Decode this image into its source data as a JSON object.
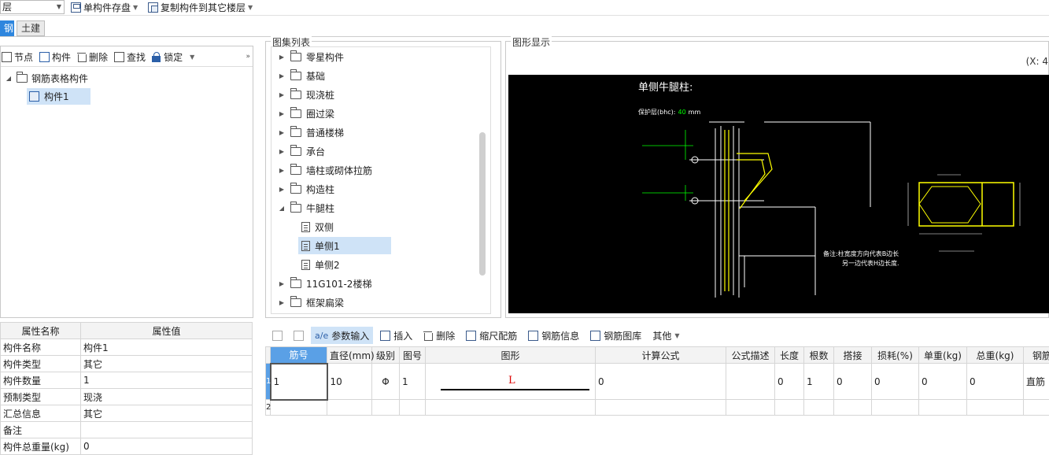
{
  "toolbar": {
    "floor_combo": "层",
    "save_label": "单构件存盘",
    "copy_label": "复制构件到其它楼层"
  },
  "module_tabs": [
    {
      "label": "钢筋",
      "active": true
    },
    {
      "label": "土建",
      "active": false
    }
  ],
  "left_tools": {
    "node": "节点",
    "component": "构件",
    "delete": "删除",
    "find": "查找",
    "lock": "锁定"
  },
  "tree": {
    "root": "钢筋表格构件",
    "child": "构件1"
  },
  "props": {
    "header_name": "属性名称",
    "header_value": "属性值",
    "rows": [
      {
        "name": "构件名称",
        "value": "构件1"
      },
      {
        "name": "构件类型",
        "value": "其它"
      },
      {
        "name": "构件数量",
        "value": "1"
      },
      {
        "name": "预制类型",
        "value": "现浇"
      },
      {
        "name": "汇总信息",
        "value": "其它"
      },
      {
        "name": "备注",
        "value": ""
      },
      {
        "name": "构件总重量(kg)",
        "value": "0"
      }
    ]
  },
  "atlas": {
    "title": "图集列表",
    "items": [
      {
        "label": "零星构件",
        "expanded": false
      },
      {
        "label": "基础",
        "expanded": false
      },
      {
        "label": "现浇桩",
        "expanded": false
      },
      {
        "label": "圈过梁",
        "expanded": false
      },
      {
        "label": "普通楼梯",
        "expanded": false
      },
      {
        "label": "承台",
        "expanded": false
      },
      {
        "label": "墙柱或砌体拉筋",
        "expanded": false
      },
      {
        "label": "构造柱",
        "expanded": false
      },
      {
        "label": "牛腿柱",
        "expanded": true
      },
      {
        "label": "11G101-2楼梯",
        "expanded": false
      },
      {
        "label": "框架扁梁",
        "expanded": false
      }
    ],
    "children": [
      {
        "label": "双侧"
      },
      {
        "label": "单侧1"
      },
      {
        "label": "单侧2"
      }
    ]
  },
  "graphic": {
    "title": "图形显示",
    "coord": "(X: 4",
    "drawing_title": "单侧牛腿柱:",
    "cover_label": "保护层(bhc):",
    "cover_value": "40",
    "cover_unit": "mm",
    "note_line1": "备注:柱宽度方向代表B边长",
    "note_line2": "另一边代表H边长度.",
    "colors": {
      "bg": "#000000",
      "line": "#ffffff",
      "accent": "#ffff00",
      "dim": "#00ff00"
    }
  },
  "bottom_tools": {
    "up": "",
    "down": "",
    "param": "参数输入",
    "insert": "插入",
    "delete": "删除",
    "scale": "缩尺配筋",
    "info": "钢筋信息",
    "library": "钢筋图库",
    "other": "其他"
  },
  "grid": {
    "headers": [
      "筋号",
      "直径(mm)",
      "级别",
      "图号",
      "图形",
      "计算公式",
      "公式描述",
      "长度",
      "根数",
      "搭接",
      "损耗(%)",
      "单重(kg)",
      "总重(kg)",
      "钢筋"
    ],
    "rows": [
      {
        "num": "1",
        "cells": [
          "1",
          "10",
          "Φ",
          "1",
          "L",
          "0",
          "",
          "0",
          "1",
          "0",
          "0",
          "0",
          "0",
          "直筋"
        ]
      },
      {
        "num": "2",
        "cells": [
          "",
          "",
          "",
          "",
          "",
          "",
          "",
          "",
          "",
          "",
          "",
          "",
          "",
          ""
        ]
      }
    ]
  }
}
